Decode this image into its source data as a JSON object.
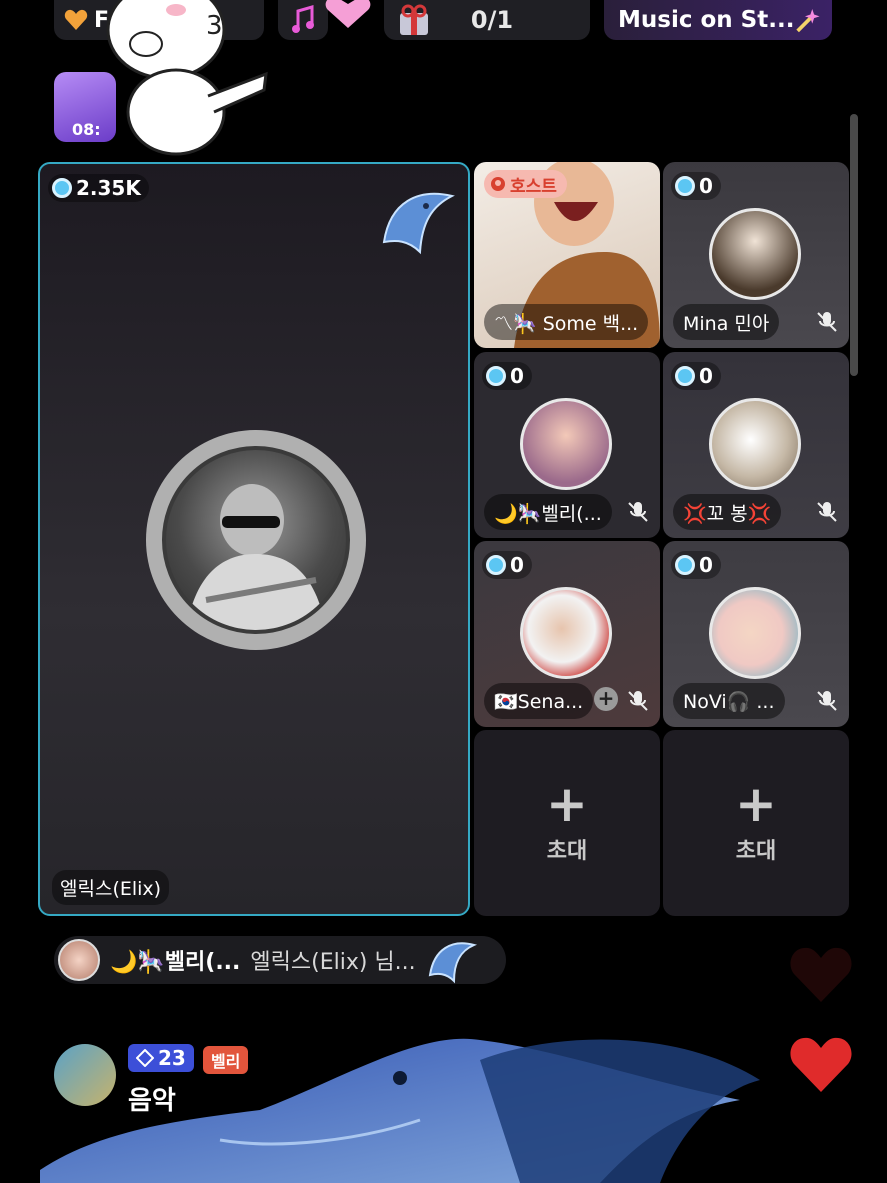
{
  "top_bar": {
    "fan_label": "F",
    "music_note_icon": "music-note-icon",
    "seat_count": "0/1",
    "music_label": "Music on St..."
  },
  "gift_timer": {
    "time": "08:"
  },
  "main_speaker": {
    "score": "2.35K",
    "name": "엘릭스(Elix)"
  },
  "seats": [
    {
      "host_label": "호스트",
      "name": "〽🎠 Some 백..."
    },
    {
      "score": "0",
      "name": "Mina 민아"
    },
    {
      "score": "0",
      "name": "🌙🎠벨리(..."
    },
    {
      "score": "0",
      "name": "💢꼬 봉💢"
    },
    {
      "score": "0",
      "name": "🇰🇷Sena..."
    },
    {
      "score": "0",
      "name": "NoVi🎧 ..."
    }
  ],
  "invite_slots": [
    {
      "label": "초대"
    },
    {
      "label": "초대"
    }
  ],
  "gift_banner": {
    "sender": "🌙🎠벨리(...",
    "message": "엘릭스(Elix) 님..."
  },
  "chat": {
    "level": "23",
    "badge": "벨리",
    "text": "음악"
  },
  "colors": {
    "main_tile_border": "#35a9c4",
    "heart": "#e02b2b",
    "level_badge": "#3c4fd8"
  }
}
